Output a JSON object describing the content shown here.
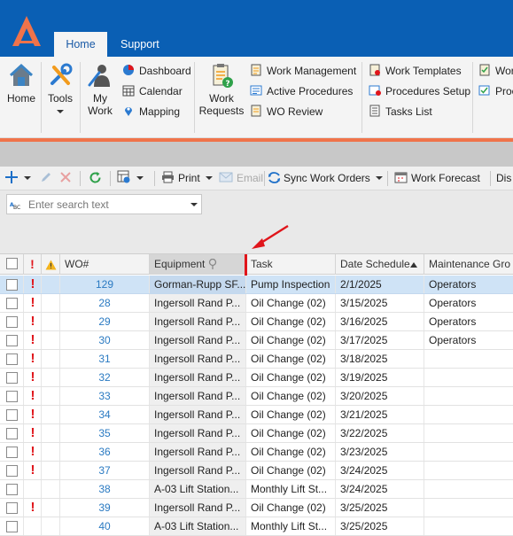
{
  "tabs": {
    "home": "Home",
    "support": "Support"
  },
  "ribbon": {
    "home": "Home",
    "tools": "Tools",
    "my_work_l1": "My",
    "my_work_l2": "Work",
    "dashboard": "Dashboard",
    "calendar": "Calendar",
    "mapping": "Mapping",
    "work_requests_l1": "Work",
    "work_requests_l2": "Requests",
    "work_management": "Work Management",
    "active_procedures": "Active Procedures",
    "wo_review": "WO Review",
    "work_templates": "Work Templates",
    "procedures_setup": "Procedures Setup",
    "tasks_list": "Tasks List",
    "wor_cut": "Wor",
    "proc_cut": "Proc"
  },
  "toolbar": {
    "print": "Print",
    "email": "Email",
    "sync": "Sync Work Orders",
    "forecast": "Work Forecast",
    "dis_cut": "Dis"
  },
  "search": {
    "placeholder": "Enter search text",
    "value": ""
  },
  "grid": {
    "columns": {
      "wo": "WO#",
      "equipment": "Equipment",
      "task": "Task",
      "date": "Date Schedule",
      "group": "Maintenance Gro"
    },
    "rows": [
      {
        "priority": "!",
        "wo": "129",
        "equipment": "Gorman-Rupp SF...",
        "task": "Pump Inspection",
        "date": "2/1/2025",
        "group": "Operators"
      },
      {
        "priority": "!",
        "wo": "28",
        "equipment": "Ingersoll Rand P...",
        "task": "Oil Change (02)",
        "date": "3/15/2025",
        "group": "Operators"
      },
      {
        "priority": "!",
        "wo": "29",
        "equipment": "Ingersoll Rand P...",
        "task": "Oil Change (02)",
        "date": "3/16/2025",
        "group": "Operators"
      },
      {
        "priority": "!",
        "wo": "30",
        "equipment": "Ingersoll Rand P...",
        "task": "Oil Change (02)",
        "date": "3/17/2025",
        "group": "Operators"
      },
      {
        "priority": "!",
        "wo": "31",
        "equipment": "Ingersoll Rand P...",
        "task": "Oil Change (02)",
        "date": "3/18/2025",
        "group": ""
      },
      {
        "priority": "!",
        "wo": "32",
        "equipment": "Ingersoll Rand P...",
        "task": "Oil Change (02)",
        "date": "3/19/2025",
        "group": ""
      },
      {
        "priority": "!",
        "wo": "33",
        "equipment": "Ingersoll Rand P...",
        "task": "Oil Change (02)",
        "date": "3/20/2025",
        "group": ""
      },
      {
        "priority": "!",
        "wo": "34",
        "equipment": "Ingersoll Rand P...",
        "task": "Oil Change (02)",
        "date": "3/21/2025",
        "group": ""
      },
      {
        "priority": "!",
        "wo": "35",
        "equipment": "Ingersoll Rand P...",
        "task": "Oil Change (02)",
        "date": "3/22/2025",
        "group": ""
      },
      {
        "priority": "!",
        "wo": "36",
        "equipment": "Ingersoll Rand P...",
        "task": "Oil Change (02)",
        "date": "3/23/2025",
        "group": ""
      },
      {
        "priority": "!",
        "wo": "37",
        "equipment": "Ingersoll Rand P...",
        "task": "Oil Change (02)",
        "date": "3/24/2025",
        "group": ""
      },
      {
        "priority": "",
        "wo": "38",
        "equipment": "A-03 Lift Station...",
        "task": "Monthly Lift St...",
        "date": "3/24/2025",
        "group": ""
      },
      {
        "priority": "!",
        "wo": "39",
        "equipment": "Ingersoll Rand P...",
        "task": "Oil Change (02)",
        "date": "3/25/2025",
        "group": ""
      },
      {
        "priority": "",
        "wo": "40",
        "equipment": "A-03 Lift Station...",
        "task": "Monthly Lift St...",
        "date": "3/25/2025",
        "group": ""
      }
    ]
  },
  "colors": {
    "title_bar": "#0a5fb4",
    "accent_orange": "#f0734a",
    "priority_red": "#e0151b",
    "link_blue": "#2a7ac2",
    "selected_row": "#cfe3f6"
  }
}
